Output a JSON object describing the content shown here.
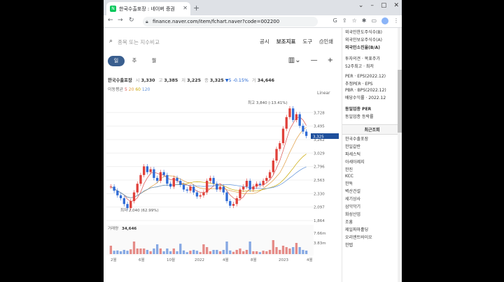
{
  "browser": {
    "tab_title": "한국수출포장 : 네이버 증권",
    "url": "finance.naver.com/item/fchart.naver?code=002200"
  },
  "search": {
    "placeholder": "종목 또는 지수비교"
  },
  "menu": {
    "items": [
      "공시",
      "보조지표",
      "도구",
      "인쇄"
    ]
  },
  "periods": [
    "일",
    "주",
    "월"
  ],
  "active_period": "일",
  "quote": {
    "name": "한국수출포장",
    "open_label": "시",
    "open": "3,330",
    "high_label": "고",
    "high": "3,385",
    "low_label": "저",
    "low": "3,225",
    "close_label": "종",
    "close": "3,325",
    "change": "▼5",
    "change_pct": "-0.15%",
    "vol_label": "거",
    "volume": "34,646"
  },
  "ma": {
    "label": "이동평균",
    "periods": [
      "5",
      "20",
      "60",
      "120"
    ]
  },
  "scale_label": "Linear",
  "chart_data": {
    "type": "candlestick",
    "y_ticks": [
      "3,728",
      "3,495",
      "3,262",
      "3,029",
      "2,796",
      "2,563",
      "2,330",
      "2,097",
      "1,864"
    ],
    "current_price": "3,325",
    "max_annotation": "최고 3,840 (-13.41%)",
    "min_annotation": "최저 2,040 (62.99%)",
    "x_ticks": [
      "2월",
      "6월",
      "10월",
      "2022",
      "4월",
      "8월",
      "2023",
      "4월"
    ],
    "volume_label": "거래량",
    "volume_value": "34,646",
    "volume_ticks": [
      "7.66m",
      "3.83m"
    ],
    "series_close": [
      2450,
      2380,
      2300,
      2250,
      2150,
      2080,
      2200,
      2350,
      2500,
      2650,
      2800,
      2700,
      2750,
      2600,
      2550,
      2700,
      2650,
      2500,
      2450,
      2600,
      2550,
      2480,
      2400,
      2380,
      2450,
      2350,
      2280,
      2300,
      2350,
      2550,
      2600,
      2500,
      2400,
      2450,
      2350,
      2200,
      2120,
      2150,
      2250,
      2400,
      2450,
      2550,
      2400,
      2450,
      2500,
      2480,
      2550,
      2600,
      2700,
      2900,
      3100,
      3200,
      3450,
      3650,
      3800,
      3600,
      3700,
      3500,
      3400,
      3325
    ]
  },
  "rightpane": {
    "top_items": [
      "외국인한도주식수(B)",
      "외국인보유주식수(A)",
      "외국인소진율(B/A)"
    ],
    "invest_items": [
      "투자의견 · 목표주가",
      "52주최고 · 최저"
    ],
    "per_items": [
      "PER · EPS(2022.12)",
      "추정PER · EPS",
      "PBR · BPS(2022.12)",
      "배당수익률 · 2022.12"
    ],
    "sector_items": [
      "동일업종 PER",
      "동일업종 등락률"
    ],
    "recent_title": "최근조회",
    "recent_items": [
      "한국수출포장",
      "한일갈란",
      "파세스틱",
      "아세아제지",
      "한진",
      "KCC",
      "한독",
      "벽산건설",
      "세기상사",
      "삼익악기",
      "화성산업",
      "조흥",
      "제일파마홀딩",
      "오리엔트바이오",
      "한텝"
    ]
  }
}
